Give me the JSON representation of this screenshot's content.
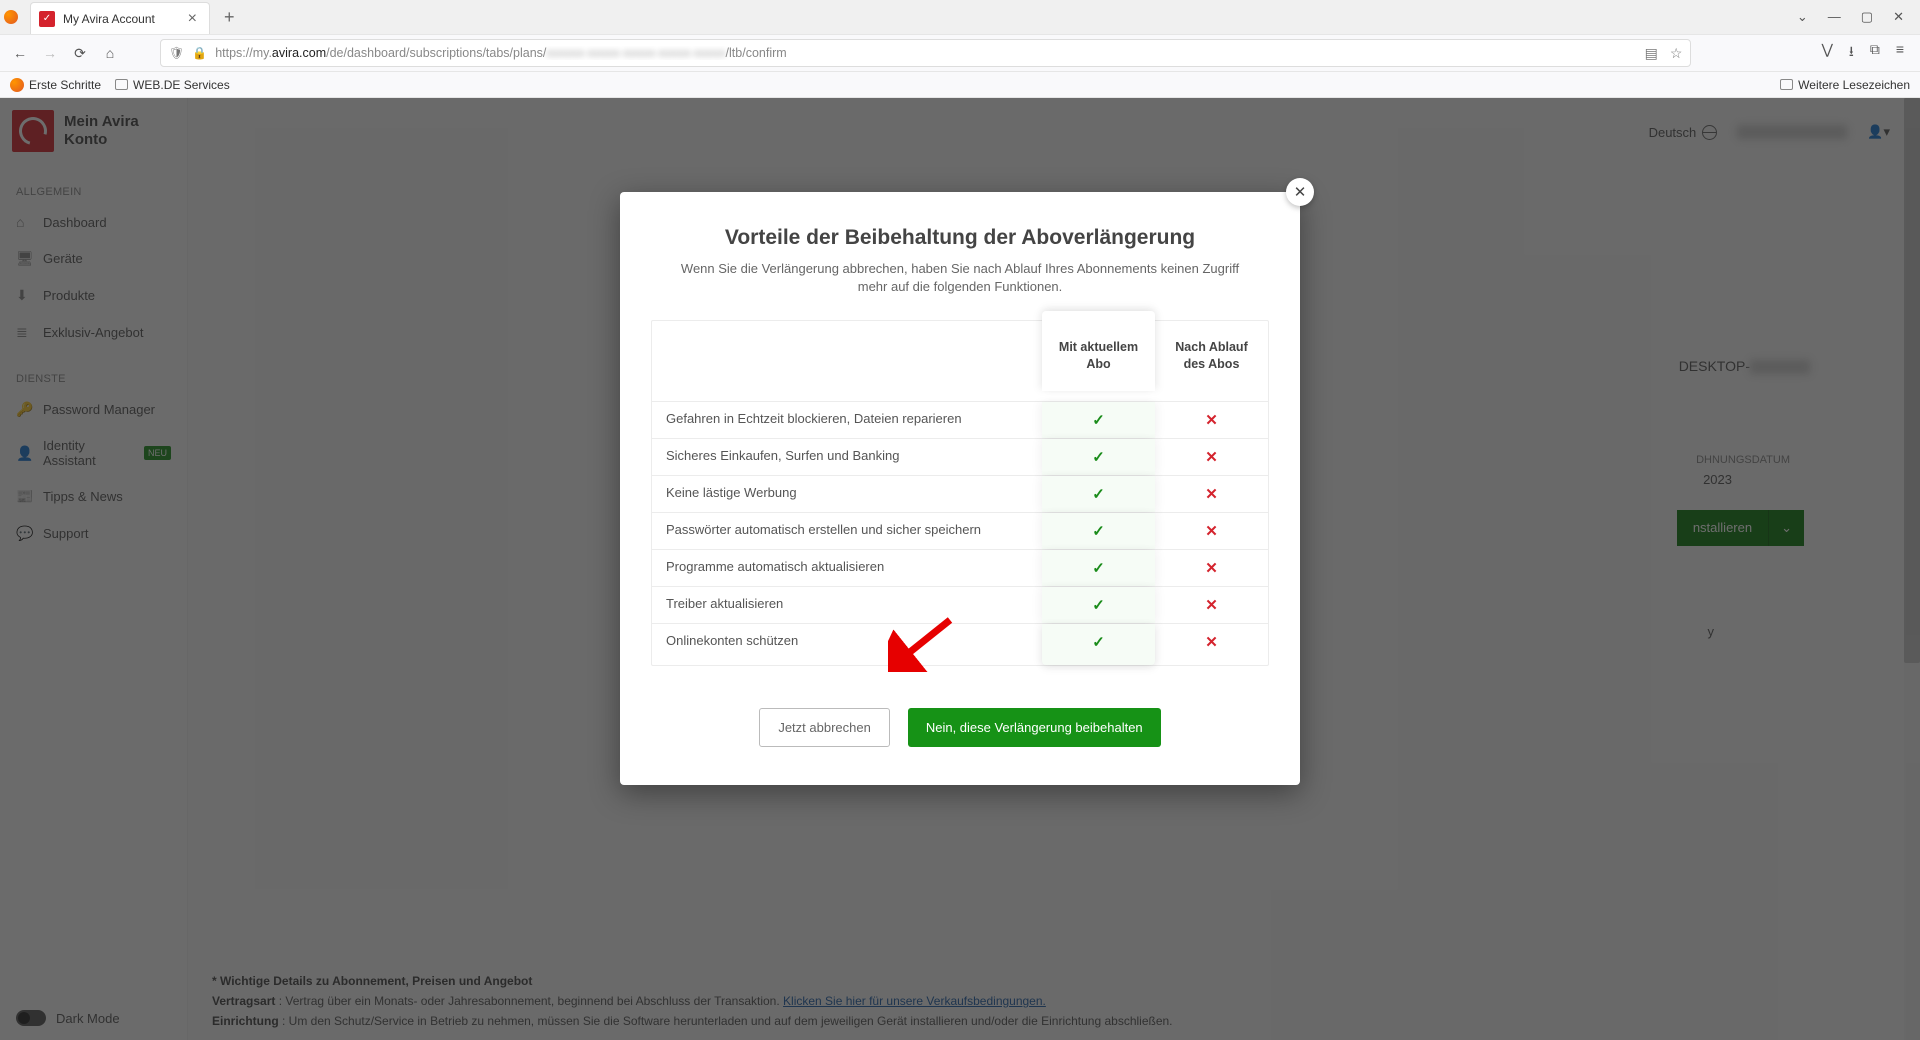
{
  "browser": {
    "tab_title": "My Avira Account",
    "url_prefix": "https://my.",
    "url_domain": "avira.com",
    "url_path_visible_1": "/de/dashboard/subscriptions/tabs/plans/",
    "url_path_visible_2": "/ltb/confirm",
    "bookmarks": {
      "first_steps": "Erste Schritte",
      "webde": "WEB.DE Services",
      "more": "Weitere Lesezeichen"
    }
  },
  "header": {
    "language": "Deutsch"
  },
  "sidebar": {
    "logo_line1": "Mein Avira",
    "logo_line2": "Konto",
    "section_general": "ALLGEMEIN",
    "section_services": "DIENSTE",
    "items_general": [
      {
        "label": "Dashboard",
        "icon": "⌂"
      },
      {
        "label": "Geräte",
        "icon": "🖥"
      },
      {
        "label": "Produkte",
        "icon": "⬇"
      },
      {
        "label": "Exklusiv-Angebot",
        "icon": "≣"
      }
    ],
    "items_services": [
      {
        "label": "Password Manager",
        "icon": "🔑"
      },
      {
        "label": "Identity Assistant",
        "icon": "👤",
        "badge": "NEU"
      },
      {
        "label": "Tipps & News",
        "icon": "📰"
      },
      {
        "label": "Support",
        "icon": "💬"
      }
    ],
    "dark_mode": "Dark Mode"
  },
  "background": {
    "desktop_prefix": "DESKTOP-",
    "billing_label": "DHNUNGSDATUM",
    "billing_year": "2023",
    "install_label": "nstallieren",
    "letter_y": "y"
  },
  "footer": {
    "details_title": "* Wichtige Details zu Abonnement, Preisen und Angebot",
    "line_contract_bold": "Vertragsart",
    "line_contract_rest": " : Vertrag über ein Monats- oder Jahresabonnement, beginnend bei Abschluss der Transaktion. ",
    "line_contract_link": "Klicken Sie hier für unsere Verkaufsbedingungen.",
    "line_setup_bold": "Einrichtung",
    "line_setup_rest": " : Um den Schutz/Service in Betrieb zu nehmen, müssen Sie die Software herunterladen und auf dem jeweiligen Gerät installieren und/oder die Einrichtung abschließen."
  },
  "modal": {
    "title": "Vorteile der Beibehaltung der Aboverlängerung",
    "subtitle": "Wenn Sie die Verlängerung abbrechen, haben Sie nach Ablauf Ihres Abonnements keinen Zugriff mehr auf die folgenden Funktionen.",
    "col_current": "Mit aktuellem Abo",
    "col_expired": "Nach Ablauf des Abos",
    "features": [
      "Gefahren in Echtzeit blockieren, Dateien reparieren",
      "Sicheres Einkaufen, Surfen und Banking",
      "Keine lästige Werbung",
      "Passwörter automatisch erstellen und sicher speichern",
      "Programme automatisch aktualisieren",
      "Treiber aktualisieren",
      "Onlinekonten schützen"
    ],
    "btn_cancel": "Jetzt abbrechen",
    "btn_keep": "Nein, diese Verlängerung beibehalten"
  }
}
